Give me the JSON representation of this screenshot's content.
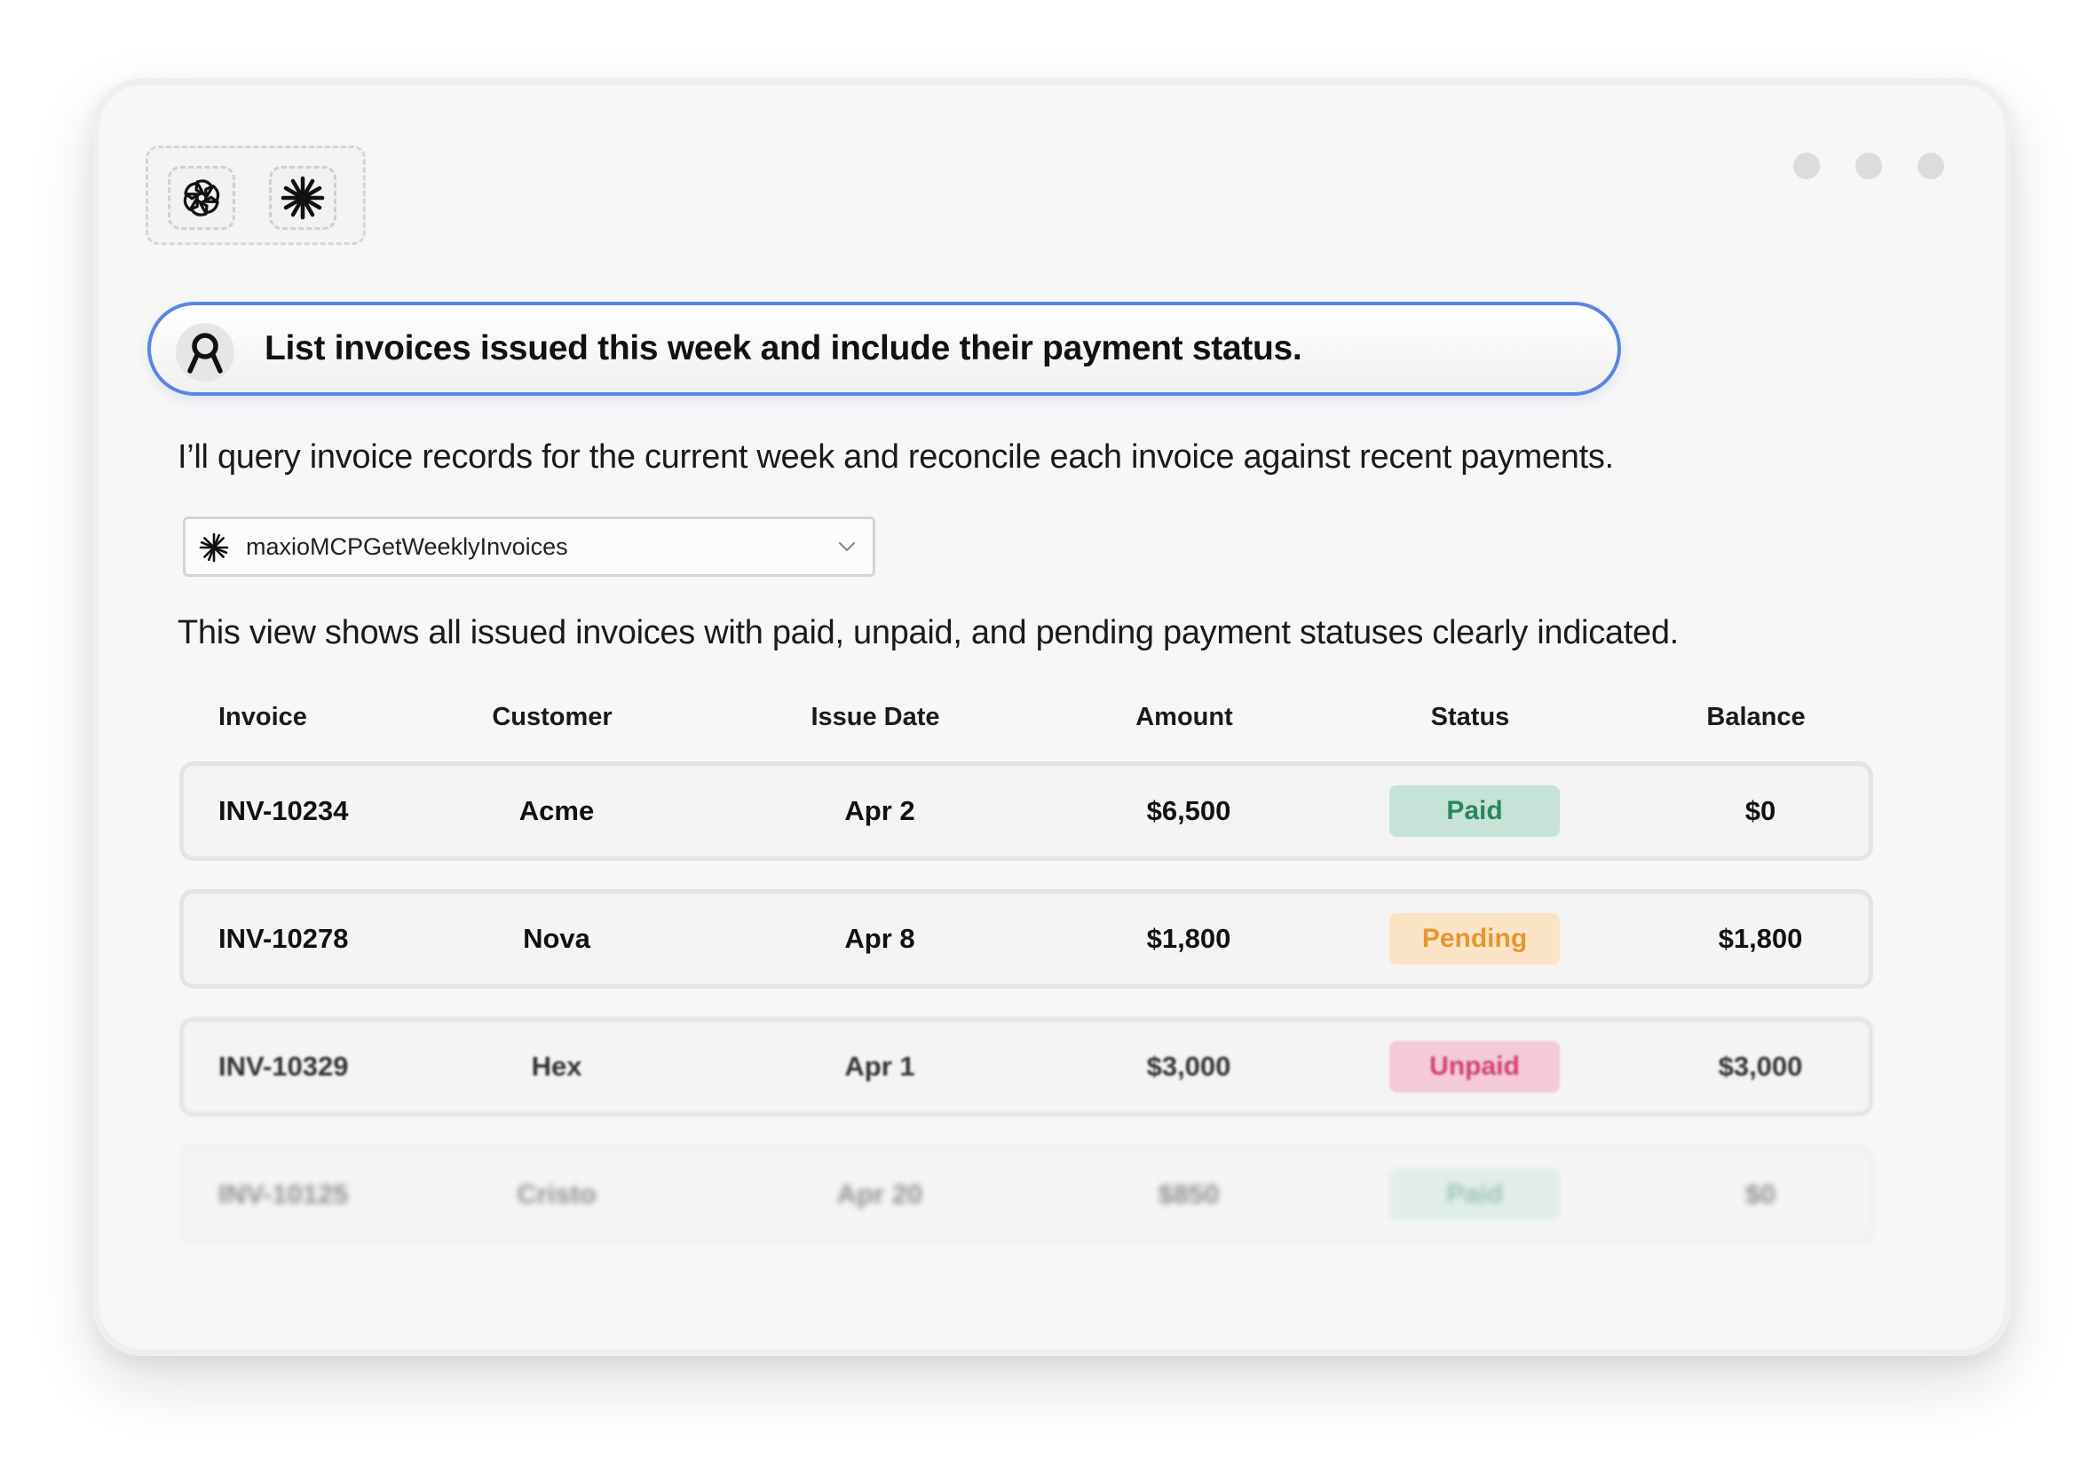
{
  "window": {
    "controls": [
      "minimize-dot",
      "maximize-dot",
      "close-dot"
    ]
  },
  "logos": [
    {
      "name": "openai-logo-icon"
    },
    {
      "name": "asterisk-logo-icon"
    }
  ],
  "prompt": {
    "avatar_icon": "maxio-logo-icon",
    "text": "List invoices issued this week and include their payment status."
  },
  "reply": {
    "intro": "I’ll query invoice records for the current week and reconcile each invoice against recent payments.",
    "summary": "This view shows all issued invoices with paid, unpaid, and pending payment statuses clearly indicated."
  },
  "tool": {
    "icon": "maxio-asterisk-icon",
    "name": "maxioMCPGetWeeklyInvoices",
    "chevron": "chevron-down-icon"
  },
  "table": {
    "headers": {
      "invoice": "Invoice",
      "customer": "Customer",
      "issue_date": "Issue Date",
      "amount": "Amount",
      "status": "Status",
      "balance": "Balance"
    },
    "rows": [
      {
        "invoice": "INV-10234",
        "customer": "Acme",
        "issue_date": "Apr 2",
        "amount": "$6,500",
        "status": "Paid",
        "balance": "$0"
      },
      {
        "invoice": "INV-10278",
        "customer": "Nova",
        "issue_date": "Apr 8",
        "amount": "$1,800",
        "status": "Pending",
        "balance": "$1,800"
      },
      {
        "invoice": "INV-10329",
        "customer": "Hex",
        "issue_date": "Apr 1",
        "amount": "$3,000",
        "status": "Unpaid",
        "balance": "$3,000"
      },
      {
        "invoice": "INV-10125",
        "customer": "Cristo",
        "issue_date": "Apr 20",
        "amount": "$850",
        "status": "Paid",
        "balance": "$0"
      }
    ]
  },
  "colors": {
    "accent_border": "#5b84e6",
    "paid_bg": "#c7e3d8",
    "paid_text": "#2a8660",
    "pending_bg": "#fbe3c6",
    "pending_text": "#e6962e",
    "unpaid_bg": "#f4cad6",
    "unpaid_text": "#d0416f"
  }
}
